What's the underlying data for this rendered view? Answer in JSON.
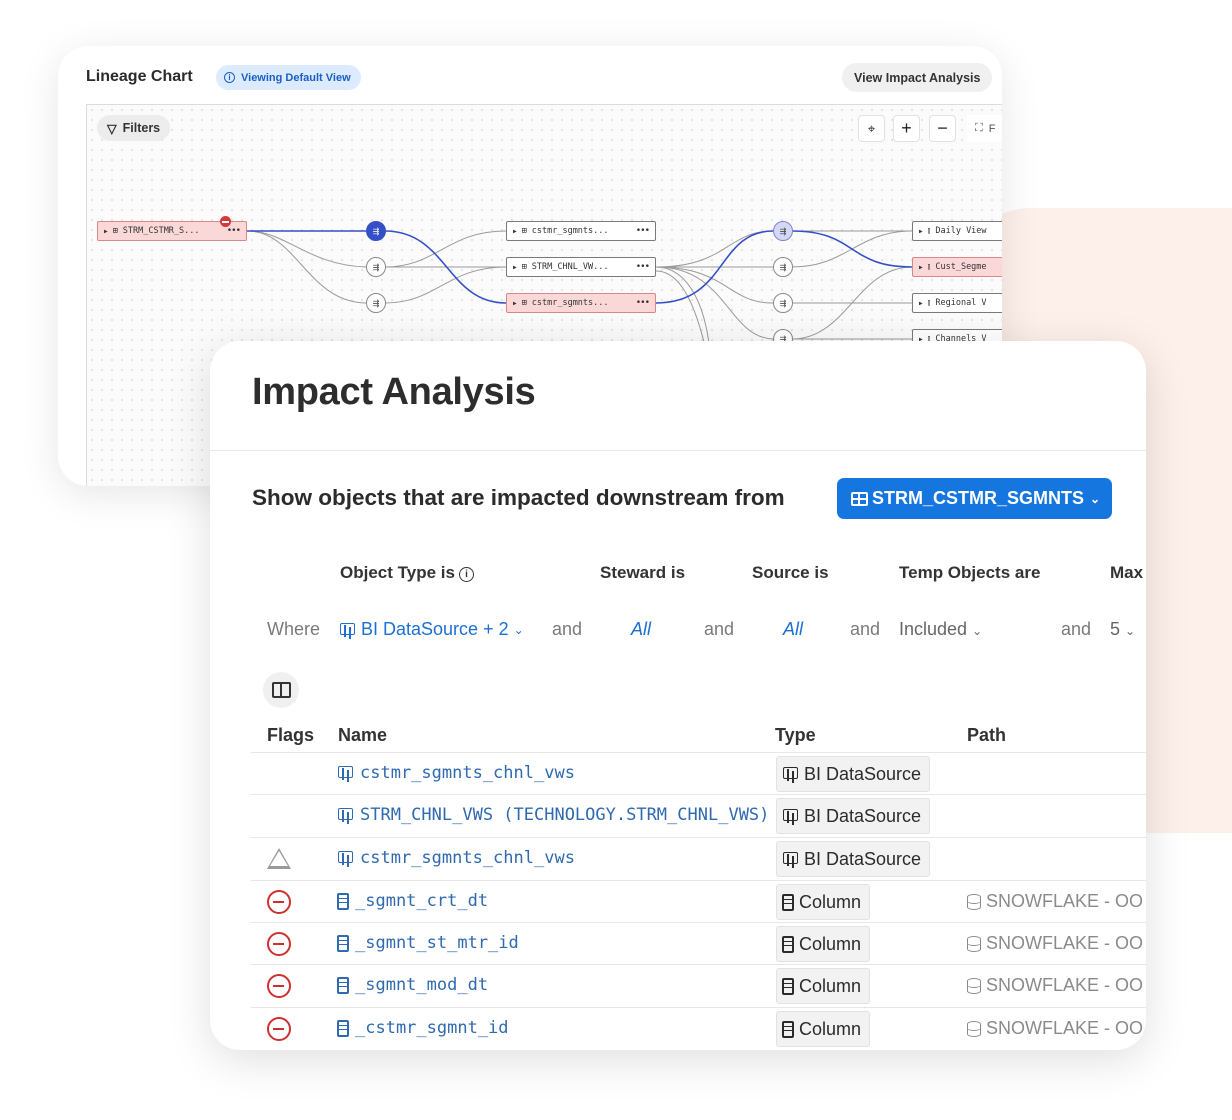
{
  "lineage": {
    "title": "Lineage Chart",
    "view_pill": "Viewing Default View",
    "view_impact_button": "View Impact Analysis",
    "filters_label": "Filters",
    "fit_label": "F",
    "nodes": {
      "source": "STRM_CSTMR_S...",
      "mid1": "cstmr_sgmnts...",
      "mid2": "STRM_CHNL_VW...",
      "mid3": "cstmr_sgmnts...",
      "out1": "Daily View",
      "out2": "Cust_Segme",
      "out3": "Regional V",
      "out4": "Channels V"
    }
  },
  "impact": {
    "title": "Impact Analysis",
    "show_text": "Show objects that are impacted downstream from",
    "source_selector": "STRM_CSTMR_SGMNTS",
    "filter_headers": {
      "object_type": "Object Type is",
      "steward": "Steward is",
      "source": "Source is",
      "temp_objects": "Temp Objects are",
      "max": "Max"
    },
    "filter_values": {
      "where": "Where",
      "object_type": "BI DataSource + 2",
      "and": "and",
      "steward": "All",
      "source": "All",
      "temp_objects": "Included",
      "max": "5"
    },
    "table": {
      "headers": {
        "flags": "Flags",
        "name": "Name",
        "type": "Type",
        "path": "Path"
      },
      "rows": [
        {
          "flag": "",
          "name": "cstmr_sgmnts_chnl_vws",
          "type": "BI DataSource",
          "path": ""
        },
        {
          "flag": "",
          "name": "STRM_CHNL_VWS (TECHNOLOGY.STRM_CHNL_VWS)",
          "type": "BI DataSource",
          "path": ""
        },
        {
          "flag": "warning",
          "name": "cstmr_sgmnts_chnl_vws",
          "type": "BI DataSource",
          "path": ""
        },
        {
          "flag": "deleted",
          "name": "_sgmnt_crt_dt",
          "type": "Column",
          "path": "SNOWFLAKE - OO"
        },
        {
          "flag": "deleted",
          "name": "_sgmnt_st_mtr_id",
          "type": "Column",
          "path": "SNOWFLAKE - OO"
        },
        {
          "flag": "deleted",
          "name": "_sgmnt_mod_dt",
          "type": "Column",
          "path": "SNOWFLAKE - OO"
        },
        {
          "flag": "deleted",
          "name": "_cstmr_sgmnt_id",
          "type": "Column",
          "path": "SNOWFLAKE - OO"
        }
      ]
    }
  },
  "colors": {
    "accent_blue": "#1676e0",
    "link_blue": "#2f6ab1",
    "danger_red": "#cf2f2f",
    "lineage_edge": "#3550c7",
    "blob": "#fdf0ea"
  }
}
